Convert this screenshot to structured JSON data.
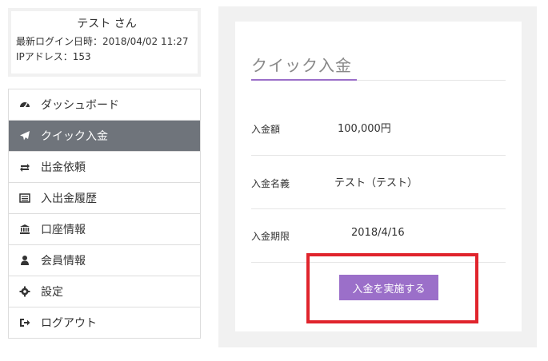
{
  "user": {
    "name": "テスト さん",
    "last_login": "最新ログイン日時：2018/04/02 11:27",
    "ip": "IPアドレス：153"
  },
  "menu": {
    "items": [
      {
        "label": "ダッシュボード",
        "icon": "dashboard-icon"
      },
      {
        "label": "クイック入金",
        "icon": "paper-plane-icon",
        "active": true
      },
      {
        "label": "出金依頼",
        "icon": "retweet-icon"
      },
      {
        "label": "入出金履歴",
        "icon": "list-alt-icon"
      },
      {
        "label": "口座情報",
        "icon": "bank-icon"
      },
      {
        "label": "会員情報",
        "icon": "user-icon"
      },
      {
        "label": "設定",
        "icon": "gear-icon"
      },
      {
        "label": "ログアウト",
        "icon": "sign-out-icon"
      }
    ]
  },
  "main": {
    "title": "クイック入金",
    "fields": [
      {
        "label": "入金額",
        "value": "100,000円"
      },
      {
        "label": "入金名義",
        "value": "テスト（テスト）"
      },
      {
        "label": "入金期限",
        "value": "2018/4/16"
      }
    ],
    "submit_label": "入金を実施する"
  },
  "colors": {
    "accent": "#9b6fc9",
    "active_menu_bg": "#6f747b",
    "highlight": "#e0242c"
  }
}
